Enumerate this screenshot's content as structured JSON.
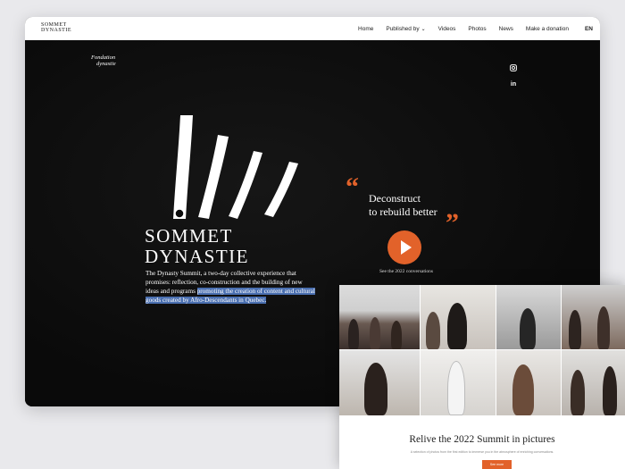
{
  "navbar": {
    "logo_line1": "SOMMET",
    "logo_line2": "DYNASTIE",
    "items": [
      "Home",
      "Published by",
      "Videos",
      "Photos",
      "News",
      "Make a donation"
    ],
    "lang": "EN"
  },
  "hero": {
    "fondation_line1": "Fondation",
    "fondation_line2": "dynastie",
    "brand_line1": "SOMMET",
    "brand_line2": "DYNASTIE",
    "desc_plain": "The Dynasty Summit, a two-day collective experience that promises: reflection, co-construction and the building of new ideas and programs ",
    "desc_highlight": "promoting the creation of content and cultural goods created by Afro-Descendants in Quebec.",
    "headline_line1": "Deconstruct",
    "headline_line2": "to rebuild better",
    "video_caption": "See the 2022 conversations"
  },
  "social": [
    "instagram-icon",
    "linkedin-icon"
  ],
  "gallery": {
    "title": "Relive the 2022 Summit in pictures",
    "subtitle": "A selection of photos from the first edition to immerse you in the atmosphere of enriching conversations.",
    "button": "See more"
  },
  "colors": {
    "accent": "#e2622a",
    "highlight": "#4a6fb0",
    "hero_bg": "#0b0b0b"
  }
}
